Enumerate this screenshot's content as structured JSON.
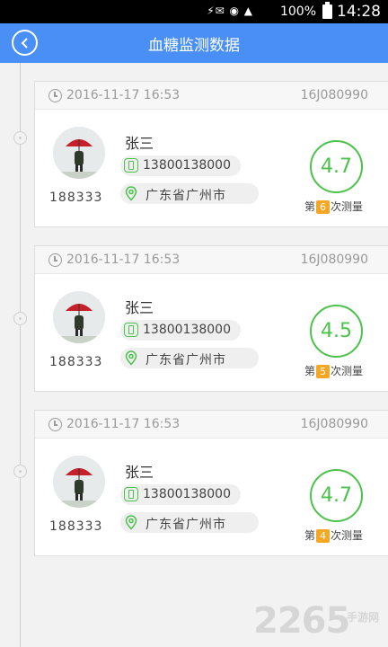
{
  "status": {
    "signal_icons": "⚡✉ ◉ ▲",
    "battery": "100%",
    "time": "14:28"
  },
  "header": {
    "title": "血糖监测数据"
  },
  "records": [
    {
      "datetime": "2016-11-17 16:53",
      "device_id": "16J080990",
      "name": "张三",
      "user_id": "188333",
      "phone": "13800138000",
      "address": "广东省广州市",
      "reading": "4.7",
      "count_prefix": "第",
      "count": "6",
      "count_suffix": "次测量"
    },
    {
      "datetime": "2016-11-17 16:53",
      "device_id": "16J080990",
      "name": "张三",
      "user_id": "188333",
      "phone": "13800138000",
      "address": "广东省广州市",
      "reading": "4.5",
      "count_prefix": "第",
      "count": "5",
      "count_suffix": "次测量"
    },
    {
      "datetime": "2016-11-17 16:53",
      "device_id": "16J080990",
      "name": "张三",
      "user_id": "188333",
      "phone": "13800138000",
      "address": "广东省广州市",
      "reading": "4.7",
      "count_prefix": "第",
      "count": "4",
      "count_suffix": "次测量"
    }
  ],
  "watermark": {
    "text": "2265",
    "sub": "手游网"
  },
  "colors": {
    "accent": "#4a8ff5",
    "green": "#4cc24c",
    "badge": "#f5a623"
  }
}
